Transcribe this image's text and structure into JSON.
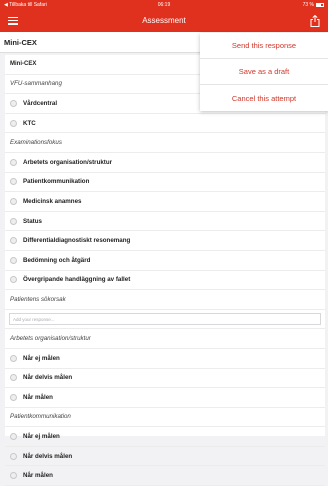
{
  "statusbar": {
    "back": "◀ Tillbaka till Safari",
    "time": "06:19",
    "battery": "73 %"
  },
  "navbar": {
    "title": "Assessment"
  },
  "subheader": {
    "title": "Mini-CEX"
  },
  "menu": {
    "items": [
      "Send this response",
      "Save as a draft",
      "Cancel this attempt"
    ]
  },
  "form": {
    "title": "Mini-CEX",
    "sec1": "VFU-sammanhang",
    "sec1_opts": [
      "Vårdcentral",
      "KTC"
    ],
    "sec2": "Examinationsfokus",
    "sec2_opts": [
      "Arbetets organisation/struktur",
      "Patientkommunikation",
      "Medicinsk anamnes",
      "Status",
      "Differentialdiagnostiskt resonemang",
      "Bedömning och åtgärd",
      "Övergripande handläggning av fallet"
    ],
    "sec3": "Patientens sökorsak",
    "sec3_placeholder": "Add your response...",
    "sec4": "Arbetets organisation/struktur",
    "sec4_opts": [
      "Når ej målen",
      "Når delvis målen",
      "Når målen"
    ],
    "sec5": "Patientkommunikation",
    "sec5_opts": [
      "Når ej målen",
      "Når delvis målen",
      "Når målen"
    ]
  },
  "colors": {
    "accent": "#e0301e",
    "menu_text": "#d0372b"
  }
}
